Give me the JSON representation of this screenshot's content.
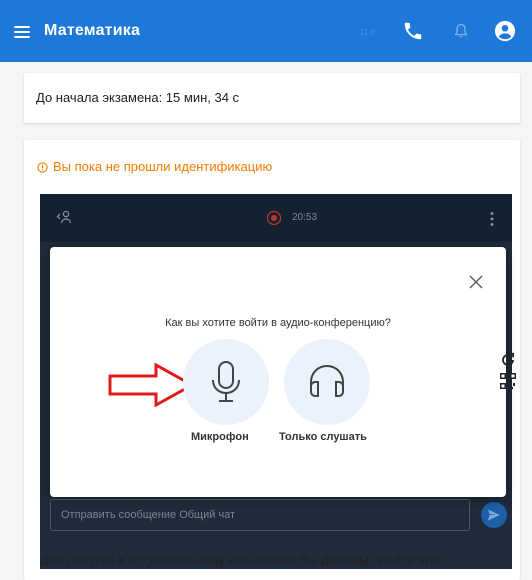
{
  "app": {
    "title": "Математика",
    "version": "11.8",
    "accent_color": "#1e78d8",
    "icons": [
      "menu-icon",
      "phone-icon",
      "bell-icon",
      "account-icon"
    ]
  },
  "timer": {
    "text": "До начала экзамена: 15 мин, 34 с"
  },
  "identification": {
    "warning": "Вы пока не прошли идентификацию",
    "warning_color": "#f57c00"
  },
  "conference": {
    "record_time": "20:53",
    "chat_placeholder": "Отправить сообщение Общий чат",
    "dialog": {
      "question": "Как вы хотите войти в аудио-конференцию?",
      "options": [
        {
          "label": "Микрофон",
          "icon": "microphone-icon"
        },
        {
          "label": "Только слушать",
          "icon": "headphones-icon"
        }
      ]
    }
  },
  "side_icons": [
    "refresh-icon",
    "qr-code-icon"
  ],
  "footer": {
    "text": "Для допуска к вступительному испытанию Вы должны пройти этап"
  }
}
